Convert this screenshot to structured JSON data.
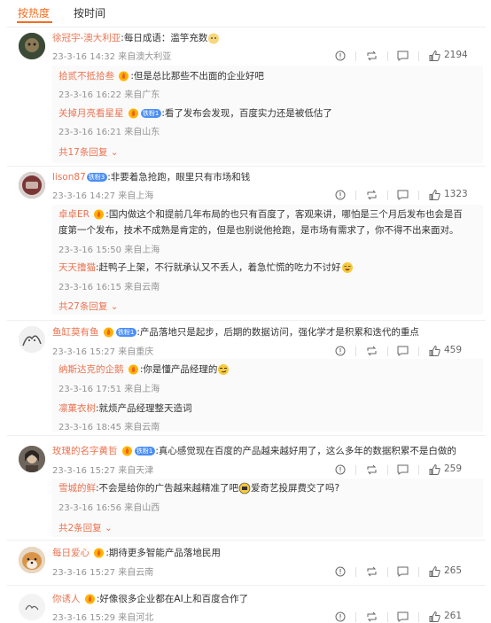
{
  "tabs": {
    "hot": "按热度",
    "time": "按时间"
  },
  "comments": [
    {
      "user": "徐冠宇-澳大利亚",
      "text": ":每日成语：滥竽充数",
      "time": "23-3-16 14:32 来自澳大利亚",
      "likes": "2194",
      "replies": [
        {
          "user": "拾贰不抵拾叁",
          "text": ":但是总比那些不出面的企业好吧",
          "time": "23-3-16 16:22 来自广东"
        },
        {
          "user": "关掉月亮看星星",
          "text": ":看了发布会发现，百度实力还是被低估了",
          "time": "23-3-16 16:21 来自山东"
        }
      ],
      "more": "共17条回复"
    },
    {
      "user": "lison87",
      "text": ":非要着急抢跑，眼里只有市场和钱",
      "time": "23-3-16 14:27 来自上海",
      "likes": "1323",
      "replies": [
        {
          "user": "卓卓ER",
          "text": ":国内做这个和提前几年布局的也只有百度了，客观来讲，哪怕是三个月后发布也会是百度第一个发布，技术不成熟是肯定的，但是也别说他抢跑，是市场有需求了，你不得不出来面对。",
          "time": "23-3-16 15:50 来自上海"
        },
        {
          "user": "天天撸猫",
          "text": ":赶鸭子上架，不行就承认又不丢人，着急忙慌的吃力不讨好",
          "time": "23-3-16 16:15 来自云南"
        }
      ],
      "more": "共27条回复"
    },
    {
      "user": "鱼缸莫有鱼",
      "text": ":产品落地只是起步，后期的数据访问，强化学才是积累和迭代的重点",
      "time": "23-3-16 15:27 来自重庆",
      "likes": "459",
      "replies": [
        {
          "user": "纳斯达克的企鹅",
          "text": ":你是懂产品经理的",
          "time": "23-3-16 17:51 来自上海"
        },
        {
          "user": "凛菓衣树",
          "text": ":就烦产品经理整天造词",
          "time": "23-3-16 18:45 来自云南"
        }
      ],
      "more": ""
    },
    {
      "user": "玫瑰的名字黄哲",
      "text": ":真心感觉现在百度的产品越来越好用了，这么多年的数据积累不是白做的",
      "time": "23-3-16 15:27 来自天津",
      "likes": "259",
      "replies": [
        {
          "user": "雪城的鲜",
          "text": ":不会是给你的广告越来越精准了吧",
          "text2": "爱奇艺投屏费交了吗?",
          "time": "23-3-16 16:56 来自山西"
        }
      ],
      "more": "共2条回复"
    },
    {
      "user": "每日爱心",
      "text": ":期待更多智能产品落地民用",
      "time": "23-3-16 15:27 来自云南",
      "likes": "265",
      "replies": [],
      "more": ""
    },
    {
      "user": "你诱人",
      "text": ":好像很多企业都在AI上和百度合作了",
      "time": "23-3-16 15:29 来自河北",
      "likes": "261",
      "replies": [],
      "more": ""
    }
  ],
  "vip_labels": {
    "l1": "铁粉1",
    "l3": "铁粉3"
  },
  "colors": {
    "accent": "#f56d1f",
    "username": "#eb7350",
    "meta": "#939393"
  },
  "icons": [
    "report-icon",
    "repost-icon",
    "comment-icon",
    "like-icon",
    "flame-badge-icon"
  ]
}
